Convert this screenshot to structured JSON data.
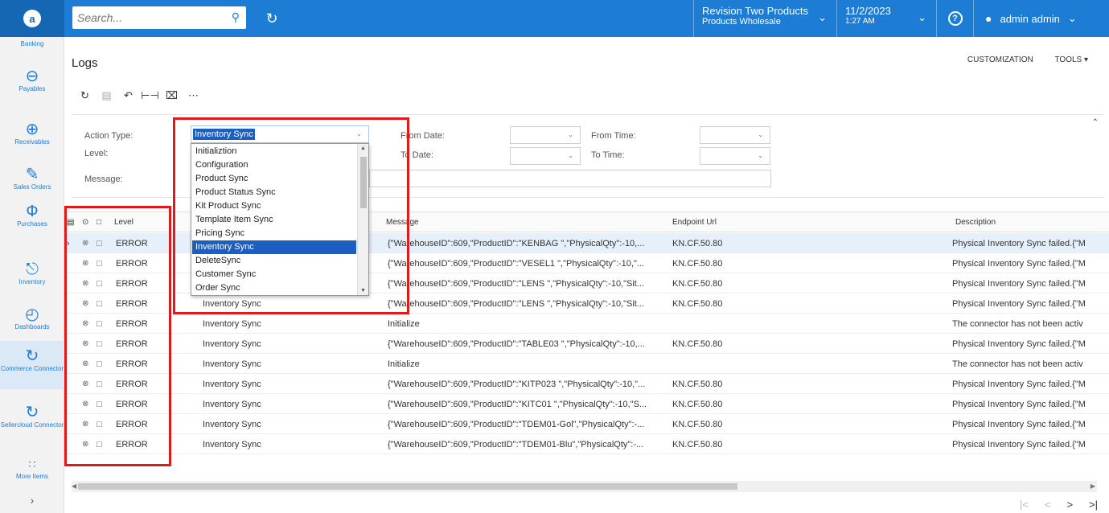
{
  "topbar": {
    "search_placeholder": "Search...",
    "company_name": "Revision Two Products",
    "company_branch": "Products Wholesale",
    "date": "11/2/2023",
    "time": "1:27 AM",
    "user": "admin admin"
  },
  "sidebar": {
    "items": [
      {
        "label": "Banking",
        "icon": "bank-icon"
      },
      {
        "label": "Payables",
        "icon": "minus-circle-icon"
      },
      {
        "label": "Receivables",
        "icon": "plus-circle-icon"
      },
      {
        "label": "Sales Orders",
        "icon": "pencil-icon"
      },
      {
        "label": "Purchases",
        "icon": "cart-icon"
      },
      {
        "label": "Inventory",
        "icon": "truck-icon"
      },
      {
        "label": "Dashboards",
        "icon": "gauge-icon"
      },
      {
        "label": "Commerce Connector",
        "icon": "sync-icon"
      },
      {
        "label": "Sellercloud Connector",
        "icon": "sync-icon"
      },
      {
        "label": "More Items",
        "icon": "grid-icon"
      }
    ]
  },
  "page": {
    "title": "Logs",
    "customization": "CUSTOMIZATION",
    "tools": "TOOLS ▾"
  },
  "filters": {
    "action_type_label": "Action Type:",
    "level_label": "Level:",
    "message_label": "Message:",
    "from_date_label": "From Date:",
    "to_date_label": "To Date:",
    "from_time_label": "From Time:",
    "to_time_label": "To Time:"
  },
  "dropdown": {
    "selected": "Inventory Sync",
    "options": [
      "Initializtion",
      "Configuration",
      "Product Sync",
      "Product Status Sync",
      "Kit Product Sync",
      "Template Item Sync",
      "Pricing Sync",
      "Inventory Sync",
      "DeleteSync",
      "Customer Sync",
      "Order Sync"
    ]
  },
  "grid": {
    "headers": {
      "level": "Level",
      "message": "Message",
      "endpoint": "Endpoint Url",
      "description": "Description"
    },
    "rows": [
      {
        "level": "ERROR",
        "action": "Inventory Sync",
        "message": "{\"WarehouseID\":609,\"ProductID\":\"KENBAG \",\"PhysicalQty\":-10,...",
        "url": "KN.CF.50.80",
        "desc": "Physical Inventory Sync failed.{\"M"
      },
      {
        "level": "ERROR",
        "action": "Inventory Sync",
        "message": "{\"WarehouseID\":609,\"ProductID\":\"VESEL1 \",\"PhysicalQty\":-10,\"...",
        "url": "KN.CF.50.80",
        "desc": "Physical Inventory Sync failed.{\"M"
      },
      {
        "level": "ERROR",
        "action": "Inventory Sync",
        "message": "{\"WarehouseID\":609,\"ProductID\":\"LENS \",\"PhysicalQty\":-10,\"Sit...",
        "url": "KN.CF.50.80",
        "desc": "Physical Inventory Sync failed.{\"M"
      },
      {
        "level": "ERROR",
        "action": "Inventory Sync",
        "message": "{\"WarehouseID\":609,\"ProductID\":\"LENS \",\"PhysicalQty\":-10,\"Sit...",
        "url": "KN.CF.50.80",
        "desc": "Physical Inventory Sync failed.{\"M"
      },
      {
        "level": "ERROR",
        "action": "Inventory Sync",
        "message": "Initialize",
        "url": "",
        "desc": "The connector has not been activ"
      },
      {
        "level": "ERROR",
        "action": "Inventory Sync",
        "message": "{\"WarehouseID\":609,\"ProductID\":\"TABLE03 \",\"PhysicalQty\":-10,...",
        "url": "KN.CF.50.80",
        "desc": "Physical Inventory Sync failed.{\"M"
      },
      {
        "level": "ERROR",
        "action": "Inventory Sync",
        "message": "Initialize",
        "url": "",
        "desc": "The connector has not been activ"
      },
      {
        "level": "ERROR",
        "action": "Inventory Sync",
        "message": "{\"WarehouseID\":609,\"ProductID\":\"KITP023 \",\"PhysicalQty\":-10,\"...",
        "url": "KN.CF.50.80",
        "desc": "Physical Inventory Sync failed.{\"M"
      },
      {
        "level": "ERROR",
        "action": "Inventory Sync",
        "message": "{\"WarehouseID\":609,\"ProductID\":\"KITC01 \",\"PhysicalQty\":-10,\"S...",
        "url": "KN.CF.50.80",
        "desc": "Physical Inventory Sync failed.{\"M"
      },
      {
        "level": "ERROR",
        "action": "Inventory Sync",
        "message": "{\"WarehouseID\":609,\"ProductID\":\"TDEM01-Gol\",\"PhysicalQty\":-...",
        "url": "KN.CF.50.80",
        "desc": "Physical Inventory Sync failed.{\"M"
      },
      {
        "level": "ERROR",
        "action": "Inventory Sync",
        "message": "{\"WarehouseID\":609,\"ProductID\":\"TDEM01-Blu\",\"PhysicalQty\":-...",
        "url": "KN.CF.50.80",
        "desc": "Physical Inventory Sync failed.{\"M"
      }
    ]
  }
}
